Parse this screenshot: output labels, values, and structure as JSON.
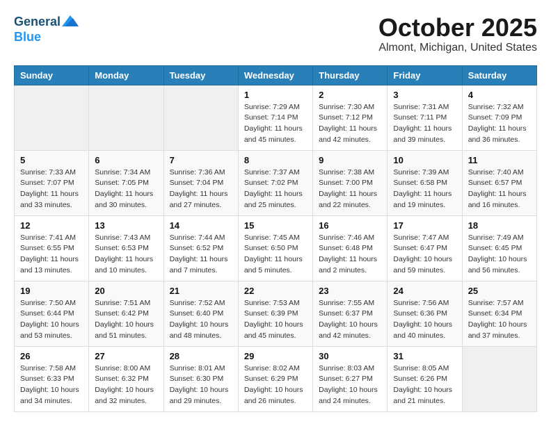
{
  "header": {
    "logo_line1": "General",
    "logo_line2": "Blue",
    "month_title": "October 2025",
    "location": "Almont, Michigan, United States"
  },
  "weekdays": [
    "Sunday",
    "Monday",
    "Tuesday",
    "Wednesday",
    "Thursday",
    "Friday",
    "Saturday"
  ],
  "weeks": [
    [
      {
        "day": "",
        "info": ""
      },
      {
        "day": "",
        "info": ""
      },
      {
        "day": "",
        "info": ""
      },
      {
        "day": "1",
        "info": "Sunrise: 7:29 AM\nSunset: 7:14 PM\nDaylight: 11 hours and 45 minutes."
      },
      {
        "day": "2",
        "info": "Sunrise: 7:30 AM\nSunset: 7:12 PM\nDaylight: 11 hours and 42 minutes."
      },
      {
        "day": "3",
        "info": "Sunrise: 7:31 AM\nSunset: 7:11 PM\nDaylight: 11 hours and 39 minutes."
      },
      {
        "day": "4",
        "info": "Sunrise: 7:32 AM\nSunset: 7:09 PM\nDaylight: 11 hours and 36 minutes."
      }
    ],
    [
      {
        "day": "5",
        "info": "Sunrise: 7:33 AM\nSunset: 7:07 PM\nDaylight: 11 hours and 33 minutes."
      },
      {
        "day": "6",
        "info": "Sunrise: 7:34 AM\nSunset: 7:05 PM\nDaylight: 11 hours and 30 minutes."
      },
      {
        "day": "7",
        "info": "Sunrise: 7:36 AM\nSunset: 7:04 PM\nDaylight: 11 hours and 27 minutes."
      },
      {
        "day": "8",
        "info": "Sunrise: 7:37 AM\nSunset: 7:02 PM\nDaylight: 11 hours and 25 minutes."
      },
      {
        "day": "9",
        "info": "Sunrise: 7:38 AM\nSunset: 7:00 PM\nDaylight: 11 hours and 22 minutes."
      },
      {
        "day": "10",
        "info": "Sunrise: 7:39 AM\nSunset: 6:58 PM\nDaylight: 11 hours and 19 minutes."
      },
      {
        "day": "11",
        "info": "Sunrise: 7:40 AM\nSunset: 6:57 PM\nDaylight: 11 hours and 16 minutes."
      }
    ],
    [
      {
        "day": "12",
        "info": "Sunrise: 7:41 AM\nSunset: 6:55 PM\nDaylight: 11 hours and 13 minutes."
      },
      {
        "day": "13",
        "info": "Sunrise: 7:43 AM\nSunset: 6:53 PM\nDaylight: 11 hours and 10 minutes."
      },
      {
        "day": "14",
        "info": "Sunrise: 7:44 AM\nSunset: 6:52 PM\nDaylight: 11 hours and 7 minutes."
      },
      {
        "day": "15",
        "info": "Sunrise: 7:45 AM\nSunset: 6:50 PM\nDaylight: 11 hours and 5 minutes."
      },
      {
        "day": "16",
        "info": "Sunrise: 7:46 AM\nSunset: 6:48 PM\nDaylight: 11 hours and 2 minutes."
      },
      {
        "day": "17",
        "info": "Sunrise: 7:47 AM\nSunset: 6:47 PM\nDaylight: 10 hours and 59 minutes."
      },
      {
        "day": "18",
        "info": "Sunrise: 7:49 AM\nSunset: 6:45 PM\nDaylight: 10 hours and 56 minutes."
      }
    ],
    [
      {
        "day": "19",
        "info": "Sunrise: 7:50 AM\nSunset: 6:44 PM\nDaylight: 10 hours and 53 minutes."
      },
      {
        "day": "20",
        "info": "Sunrise: 7:51 AM\nSunset: 6:42 PM\nDaylight: 10 hours and 51 minutes."
      },
      {
        "day": "21",
        "info": "Sunrise: 7:52 AM\nSunset: 6:40 PM\nDaylight: 10 hours and 48 minutes."
      },
      {
        "day": "22",
        "info": "Sunrise: 7:53 AM\nSunset: 6:39 PM\nDaylight: 10 hours and 45 minutes."
      },
      {
        "day": "23",
        "info": "Sunrise: 7:55 AM\nSunset: 6:37 PM\nDaylight: 10 hours and 42 minutes."
      },
      {
        "day": "24",
        "info": "Sunrise: 7:56 AM\nSunset: 6:36 PM\nDaylight: 10 hours and 40 minutes."
      },
      {
        "day": "25",
        "info": "Sunrise: 7:57 AM\nSunset: 6:34 PM\nDaylight: 10 hours and 37 minutes."
      }
    ],
    [
      {
        "day": "26",
        "info": "Sunrise: 7:58 AM\nSunset: 6:33 PM\nDaylight: 10 hours and 34 minutes."
      },
      {
        "day": "27",
        "info": "Sunrise: 8:00 AM\nSunset: 6:32 PM\nDaylight: 10 hours and 32 minutes."
      },
      {
        "day": "28",
        "info": "Sunrise: 8:01 AM\nSunset: 6:30 PM\nDaylight: 10 hours and 29 minutes."
      },
      {
        "day": "29",
        "info": "Sunrise: 8:02 AM\nSunset: 6:29 PM\nDaylight: 10 hours and 26 minutes."
      },
      {
        "day": "30",
        "info": "Sunrise: 8:03 AM\nSunset: 6:27 PM\nDaylight: 10 hours and 24 minutes."
      },
      {
        "day": "31",
        "info": "Sunrise: 8:05 AM\nSunset: 6:26 PM\nDaylight: 10 hours and 21 minutes."
      },
      {
        "day": "",
        "info": ""
      }
    ]
  ]
}
